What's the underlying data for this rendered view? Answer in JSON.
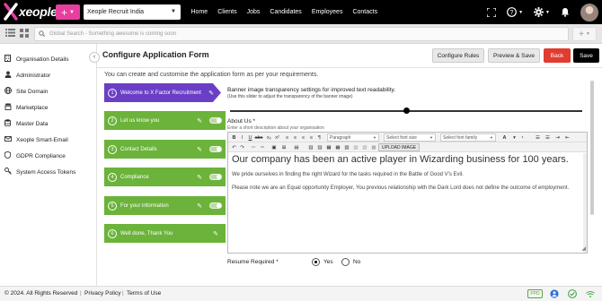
{
  "brand": {
    "logo_text": "xeople",
    "accent": "#e63fa0"
  },
  "topbar": {
    "org_select": "Xeople Recruit India",
    "nav": [
      "Home",
      "Clients",
      "Jobs",
      "Candidates",
      "Employees",
      "Contacts"
    ],
    "icons": [
      "fullscreen-icon",
      "help-icon",
      "gear-icon",
      "bell-icon",
      "avatar"
    ]
  },
  "search": {
    "placeholder": "Global Search - Something awesome is coming soon"
  },
  "sidebar": {
    "items": [
      {
        "label": "Organisation Details",
        "icon": "building-icon"
      },
      {
        "label": "Administrator",
        "icon": "user-icon"
      },
      {
        "label": "Site Domain",
        "icon": "globe-icon"
      },
      {
        "label": "Marketplace",
        "icon": "store-icon"
      },
      {
        "label": "Master Data",
        "icon": "database-icon"
      },
      {
        "label": "Xeople Smart-Email",
        "icon": "envelope-icon"
      },
      {
        "label": "GDPR Compliance",
        "icon": "shield-icon"
      },
      {
        "label": "System Access Tokens",
        "icon": "key-icon"
      }
    ]
  },
  "header": {
    "title": "Configure Application Form",
    "buttons": {
      "configure": "Configure Rules",
      "preview": "Preview & Save",
      "back": "Back",
      "save": "Save"
    }
  },
  "form": {
    "intro": "You can create and customise the application form as per your requirements.",
    "steps": [
      {
        "num": "1",
        "label": "Welcome to X Factor Recruitment",
        "active": true
      },
      {
        "num": "2",
        "label": "Let us know you",
        "active": false
      },
      {
        "num": "3",
        "label": "Contact Details",
        "active": false
      },
      {
        "num": "4",
        "label": "Compliance",
        "active": false
      },
      {
        "num": "5",
        "label": "For your information",
        "active": false
      },
      {
        "num": "6",
        "label": "Well done, Thank You",
        "active": false
      }
    ],
    "banner_title": "Banner image transparency settings for improved text readability.",
    "banner_sub": "(Use this slider to adjust the transparency of the banner image)",
    "banner_transparency_percent": 49,
    "about_label": "About Us *",
    "about_sub": "Enter a short description about your organisation",
    "toolbar": {
      "paragraph": "Paragraph",
      "font_size": "Select font size",
      "font_family": "Select font family",
      "upload": "UPLOAD IMAGE"
    },
    "editor_heading": "Our company has been an active player in Wizarding business for 100 years.",
    "editor_p1": "We pride ourselves in finding the right Wizard for the tasks required in the Battle of Good V's Evil.",
    "editor_p2": "Please note we are an Equal opportunity Employer, You previous relationship with the Dark Lord does not define the outcome of employment.",
    "resume_label": "Resume Required *",
    "resume_yes": "Yes",
    "resume_no": "No",
    "resume_selected": "Yes"
  },
  "footer": {
    "copyright": "© 2024. All Rights Reserved",
    "privacy": "Privacy Policy",
    "terms": "Terms of Use",
    "ppd": "PPD"
  }
}
